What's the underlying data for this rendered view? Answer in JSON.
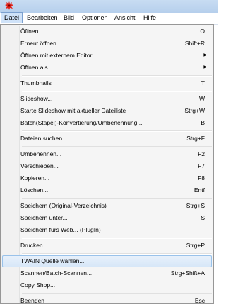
{
  "menubar": {
    "items": [
      "Datei",
      "Bearbeiten",
      "Bild",
      "Optionen",
      "Ansicht",
      "Hilfe"
    ]
  },
  "menu": {
    "items": [
      {
        "label": "Öffnen...",
        "shortcut": "O"
      },
      {
        "label": "Erneut öffnen",
        "shortcut": "Shift+R"
      },
      {
        "label": "Öffnen mit externem Editor",
        "submenu": true
      },
      {
        "label": "Öffnen als",
        "submenu": true
      },
      {
        "label": "Thumbnails",
        "shortcut": "T"
      },
      {
        "label": "Slideshow...",
        "shortcut": "W"
      },
      {
        "label": "Starte Slideshow mit aktueller Dateiliste",
        "shortcut": "Strg+W"
      },
      {
        "label": "Batch(Stapel)-Konvertierung/Umbenennung...",
        "shortcut": "B"
      },
      {
        "label": "Dateien suchen...",
        "shortcut": "Strg+F"
      },
      {
        "label": "Umbenennen...",
        "shortcut": "F2"
      },
      {
        "label": "Verschieben...",
        "shortcut": "F7"
      },
      {
        "label": "Kopieren...",
        "shortcut": "F8"
      },
      {
        "label": "Löschen...",
        "shortcut": "Entf"
      },
      {
        "label": "Speichern (Original-Verzeichnis)",
        "shortcut": "Strg+S"
      },
      {
        "label": "Speichern unter...",
        "shortcut": "S"
      },
      {
        "label": "Speichern fürs Web... (PlugIn)",
        "shortcut": ""
      },
      {
        "label": "Drucken...",
        "shortcut": "Strg+P"
      },
      {
        "label": "TWAIN Quelle wählen...",
        "shortcut": "",
        "highlighted": true
      },
      {
        "label": "Scannen/Batch-Scannen...",
        "shortcut": "Strg+Shift+A"
      },
      {
        "label": "Copy Shop...",
        "shortcut": ""
      },
      {
        "label": "Beenden",
        "shortcut": "Esc"
      }
    ]
  },
  "colors": {
    "highlight_border": "#99c2ea",
    "app_icon": "#e2231a"
  }
}
